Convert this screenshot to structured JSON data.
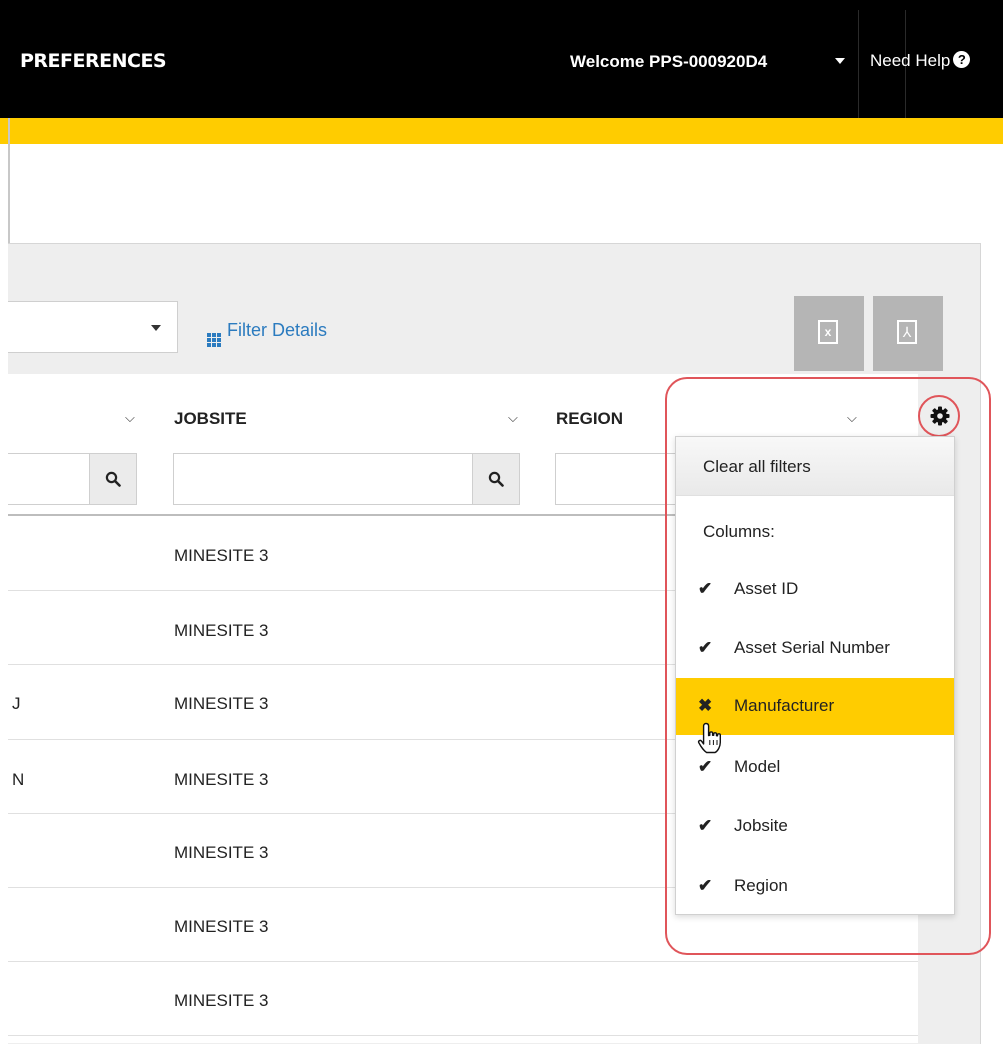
{
  "header": {
    "nav_preferences": "PREFERENCES",
    "welcome": "Welcome PPS-000920D4",
    "need_help": "Need Help",
    "help_glyph": "?"
  },
  "toolbar": {
    "filter_details": "Filter Details",
    "excel_label": "x",
    "pdf_label": "⅄"
  },
  "grid": {
    "columns": [
      "JOBSITE",
      "REGION"
    ],
    "rows": [
      {
        "left_fragment": "",
        "jobsite": "MINESITE 3"
      },
      {
        "left_fragment": "",
        "jobsite": "MINESITE 3"
      },
      {
        "left_fragment": "J",
        "jobsite": "MINESITE 3"
      },
      {
        "left_fragment": "N",
        "jobsite": "MINESITE 3"
      },
      {
        "left_fragment": "",
        "jobsite": "MINESITE 3"
      },
      {
        "left_fragment": "",
        "jobsite": "MINESITE 3"
      },
      {
        "left_fragment": "",
        "jobsite": "MINESITE 3"
      }
    ]
  },
  "column_menu": {
    "clear_all": "Clear all filters",
    "columns_label": "Columns:",
    "items": [
      {
        "label": "Asset ID",
        "mark": "✔",
        "state": "checked"
      },
      {
        "label": "Asset Serial Number",
        "mark": "✔",
        "state": "checked"
      },
      {
        "label": "Manufacturer",
        "mark": "✖",
        "state": "unchecked-hover"
      },
      {
        "label": "Model",
        "mark": "✔",
        "state": "checked"
      },
      {
        "label": "Jobsite",
        "mark": "✔",
        "state": "checked"
      },
      {
        "label": "Region",
        "mark": "✔",
        "state": "checked"
      }
    ]
  },
  "colors": {
    "brand_yellow": "#ffcc00",
    "header_black": "#000000",
    "link_blue": "#2b7bbf",
    "annotation_red": "#e0555a"
  }
}
